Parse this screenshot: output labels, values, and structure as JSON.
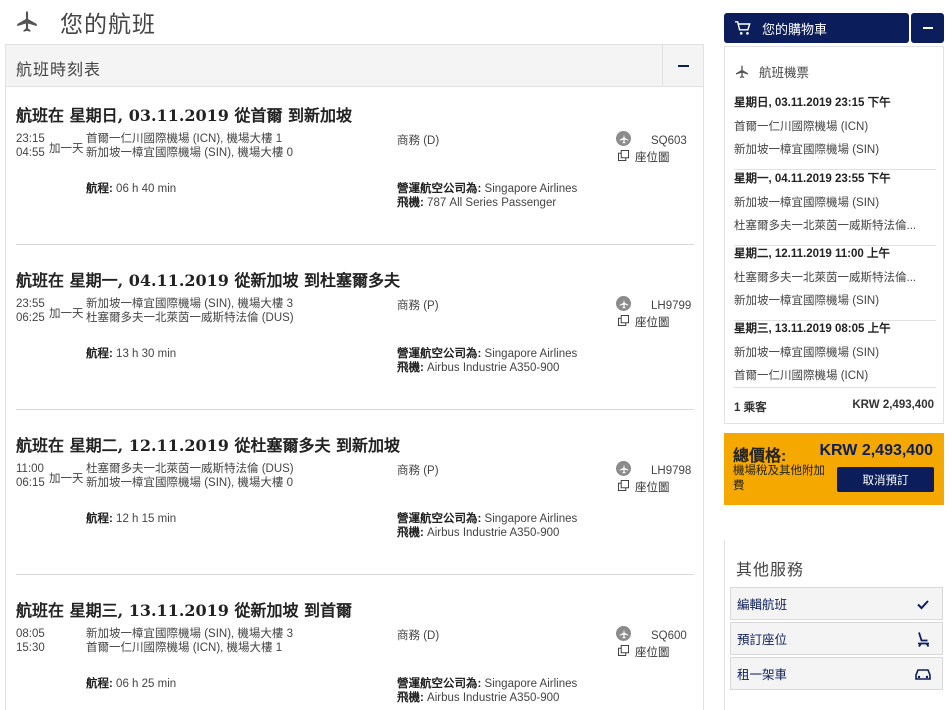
{
  "page": {
    "title": "您的航班"
  },
  "schedule": {
    "title": "航班時刻表"
  },
  "flights": [
    {
      "heading": "航班在 星期日, 03.11.2019 從首爾 到新加坡",
      "dep_time": "23:15",
      "arr_time": "04:55",
      "plus_day": "加一天",
      "dep_airport": "首爾一仁川國際機場 (ICN), 機場大樓 1",
      "arr_airport": "新加坡一樟宜國際機場 (SIN), 機場大樓 0",
      "cabin": "商務 (D)",
      "flight_no": "SQ603",
      "seatmap": "座位圖",
      "duration_label": "航程:",
      "duration": "06 h 40 min",
      "carrier_label": "營運航空公司為:",
      "carrier": "Singapore Airlines",
      "aircraft_label": "飛機:",
      "aircraft": "787 All Series Passenger"
    },
    {
      "heading": "航班在 星期一, 04.11.2019 從新加坡 到杜塞爾多夫",
      "dep_time": "23:55",
      "arr_time": "06:25",
      "plus_day": "加一天",
      "dep_airport": "新加坡一樟宜國際機場 (SIN), 機場大樓 3",
      "arr_airport": "杜塞爾多夫一北萊茵一威斯特法倫 (DUS)",
      "cabin": "商務 (P)",
      "flight_no": "LH9799",
      "seatmap": "座位圖",
      "duration_label": "航程:",
      "duration": "13 h 30 min",
      "carrier_label": "營運航空公司為:",
      "carrier": "Singapore Airlines",
      "aircraft_label": "飛機:",
      "aircraft": "Airbus Industrie A350-900"
    },
    {
      "heading": "航班在 星期二, 12.11.2019 從杜塞爾多夫 到新加坡",
      "dep_time": "11:00",
      "arr_time": "06:15",
      "plus_day": "加一天",
      "dep_airport": "杜塞爾多夫一北萊茵一威斯特法倫 (DUS)",
      "arr_airport": "新加坡一樟宜國際機場 (SIN), 機場大樓 0",
      "cabin": "商務 (P)",
      "flight_no": "LH9798",
      "seatmap": "座位圖",
      "duration_label": "航程:",
      "duration": "12 h 15 min",
      "carrier_label": "營運航空公司為:",
      "carrier": "Singapore Airlines",
      "aircraft_label": "飛機:",
      "aircraft": "Airbus Industrie A350-900"
    },
    {
      "heading": "航班在 星期三, 13.11.2019 從新加坡 到首爾",
      "dep_time": "08:05",
      "arr_time": "15:30",
      "plus_day": "",
      "dep_airport": "新加坡一樟宜國際機場 (SIN), 機場大樓 3",
      "arr_airport": "首爾一仁川國際機場 (ICN), 機場大樓 1",
      "cabin": "商務 (D)",
      "flight_no": "SQ600",
      "seatmap": "座位圖",
      "duration_label": "航程:",
      "duration": "06 h 25 min",
      "carrier_label": "營運航空公司為:",
      "carrier": "Singapore Airlines",
      "aircraft_label": "飛機:",
      "aircraft": "Airbus Industrie A350-900"
    }
  ],
  "cart": {
    "title": "您的購物車",
    "tickets_title": "航班機票",
    "segments": [
      {
        "date": "星期日, 03.11.2019 23:15 下午",
        "from": "首爾一仁川國際機場 (ICN)",
        "to": "新加坡一樟宜國際機場 (SIN)"
      },
      {
        "date": "星期一, 04.11.2019 23:55 下午",
        "from": "新加坡一樟宜國際機場 (SIN)",
        "to": "杜塞爾多夫一北萊茵一威斯特法倫..."
      },
      {
        "date": "星期二, 12.11.2019 11:00 上午",
        "from": "杜塞爾多夫一北萊茵一威斯特法倫...",
        "to": "新加坡一樟宜國際機場 (SIN)"
      },
      {
        "date": "星期三, 13.11.2019 08:05 上午",
        "from": "新加坡一樟宜國際機場 (SIN)",
        "to": "首爾一仁川國際機場 (ICN)"
      }
    ],
    "passengers": "1 乘客",
    "passenger_price": "KRW 2,493,400"
  },
  "total": {
    "label": "總價格:",
    "amount": "KRW 2,493,400",
    "tax_note": "機場稅及其他附加費",
    "cancel_label": "取消預訂"
  },
  "services": {
    "title": "其他服務",
    "items": [
      {
        "label": "編輯航班",
        "icon": "check-icon"
      },
      {
        "label": "預訂座位",
        "icon": "seat-icon"
      },
      {
        "label": "租一架車",
        "icon": "car-icon"
      }
    ]
  },
  "colors": {
    "brand_navy": "#0b1e5b",
    "accent_orange": "#f5a800",
    "panel_gray": "#f4f4f4"
  }
}
